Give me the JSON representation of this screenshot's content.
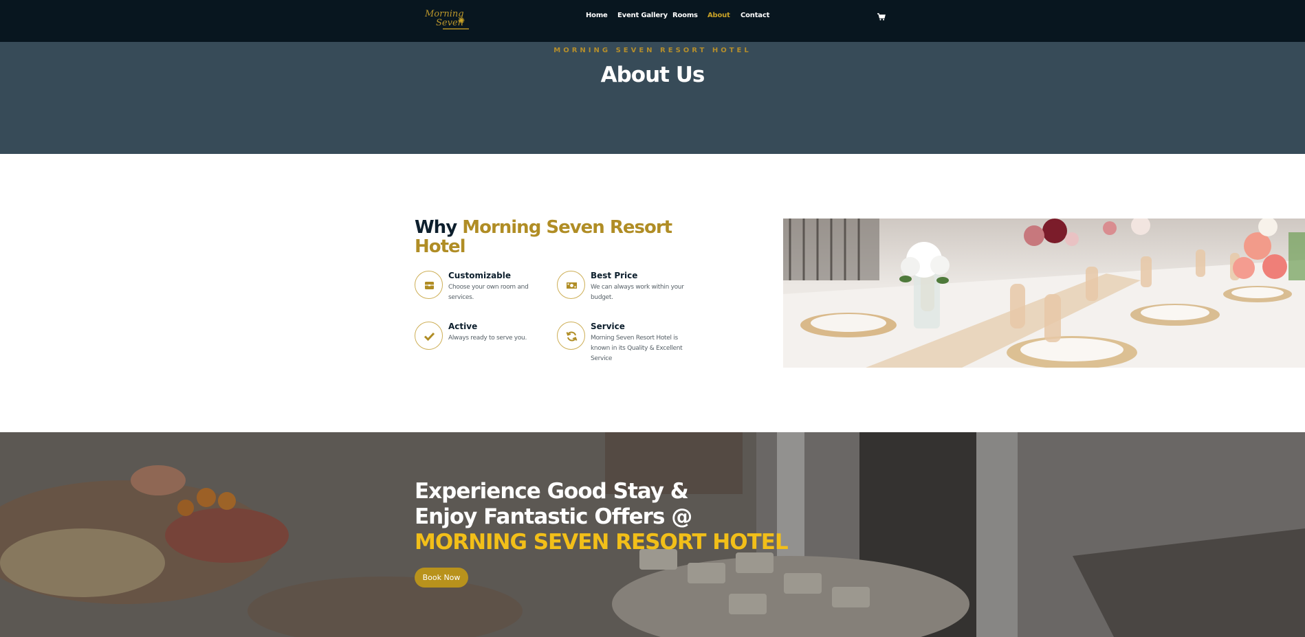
{
  "nav": {
    "logo_line1": "Morning",
    "logo_line2": "Seven",
    "items": [
      {
        "label": "Home"
      },
      {
        "label": "Event Gallery"
      },
      {
        "label": "Rooms"
      },
      {
        "label": "About",
        "active": true
      },
      {
        "label": "Contact"
      }
    ],
    "cart_icon": "cart-icon"
  },
  "hero": {
    "kicker": "MORNING SEVEN RESORT HOTEL",
    "title": "About Us"
  },
  "why": {
    "title_prefix": "Why ",
    "title_highlight": "Morning Seven Resort Hotel",
    "features": [
      {
        "icon": "box-icon",
        "title": "Customizable",
        "desc": "Choose your own room and services."
      },
      {
        "icon": "money-icon",
        "title": "Best Price",
        "desc": "We can always work within your budget."
      },
      {
        "icon": "check-icon",
        "title": "Active",
        "desc": "Always ready to serve you."
      },
      {
        "icon": "refresh-icon",
        "title": "Service",
        "desc": "Morning Seven Resort Hotel is known in its Quality & Excellent Service"
      }
    ]
  },
  "banner": {
    "line1": "Experience Good Stay &",
    "line2": "Enjoy Fantastic Offers @",
    "line3": "MORNING SEVEN RESORT HOTEL",
    "button": "Book Now"
  },
  "colors": {
    "nav_bg": "#08161f",
    "hero_bg": "#374b58",
    "gold": "#b08d25",
    "bright_gold": "#f2bf19",
    "dark_text": "#0d1f2d"
  }
}
